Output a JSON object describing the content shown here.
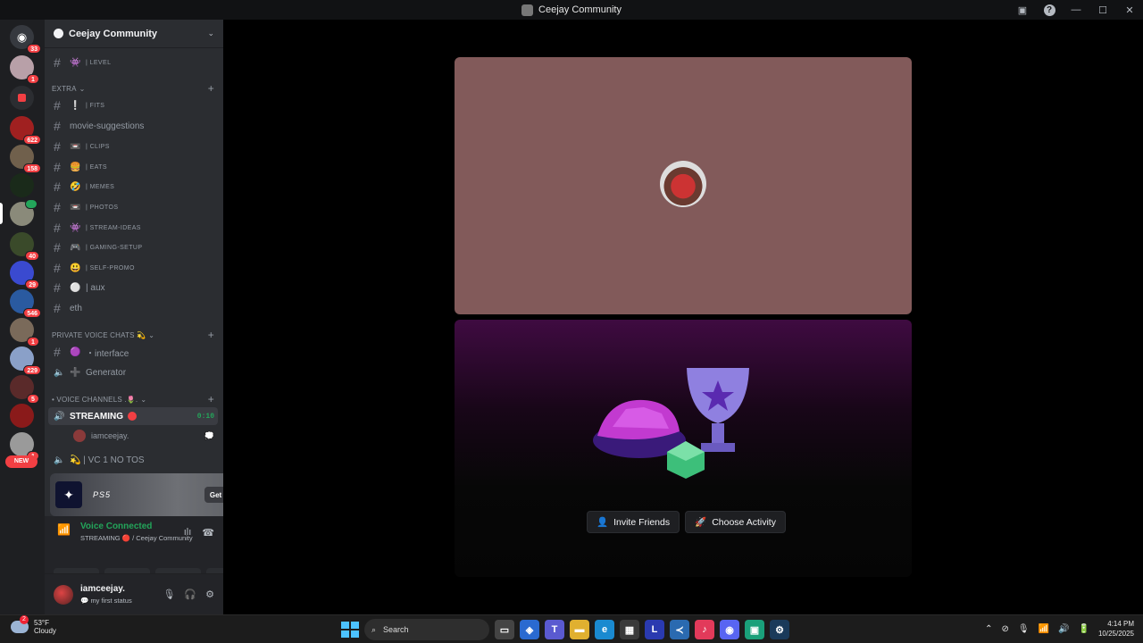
{
  "window": {
    "title": "Ceejay Community"
  },
  "guilds": {
    "badges": [
      "33",
      "1",
      "622",
      "158",
      "1",
      "40",
      "29",
      "546",
      "1",
      "229",
      "5",
      "1"
    ],
    "new_label": "NEW"
  },
  "server": {
    "name": "Ceejay Community"
  },
  "channels": {
    "top": [
      {
        "emoji": "👾",
        "name": "| level",
        "small": true
      }
    ],
    "extra_category": "EXTRA",
    "extra": [
      {
        "emoji": "❕",
        "name": "| fits",
        "small": true
      },
      {
        "emoji": "",
        "name": "movie-suggestions",
        "small": false
      },
      {
        "emoji": "📼",
        "name": "| clips",
        "small": true
      },
      {
        "emoji": "🍔",
        "name": "| eats",
        "small": true
      },
      {
        "emoji": "🤣",
        "name": "| memes",
        "small": true
      },
      {
        "emoji": "📼",
        "name": "| photos",
        "small": true
      },
      {
        "emoji": "👾",
        "name": "| stream-ideas",
        "small": true
      },
      {
        "emoji": "🎮",
        "name": "| gaming-setup",
        "small": true
      },
      {
        "emoji": "😃",
        "name": "| self-promo",
        "small": true
      },
      {
        "emoji": "⚪",
        "name": "| aux",
        "small": false
      },
      {
        "emoji": "",
        "name": "eth",
        "small": false
      }
    ],
    "private_category": "PRIVATE VOICE CHATS 💫",
    "private": [
      {
        "emoji": "🟣",
        "name": "・interface"
      },
      {
        "emoji": "➕",
        "name": "Generator"
      }
    ],
    "voice_category": "• VOICE CHANNELS .🌷.",
    "voice": [
      {
        "name": "STREAMING",
        "timer": "0:10",
        "member": "iamceejay."
      },
      {
        "name": "💫 | VC 1 NO TOS"
      }
    ]
  },
  "promo": {
    "brand": "PS5",
    "button": "Get Reward!"
  },
  "voice_panel": {
    "status": "Voice Connected",
    "detail": "STREAMING 🔴 / Ceejay Community"
  },
  "user": {
    "name": "iamceejay.",
    "status": "my first status"
  },
  "activity": {
    "invite_label": "Invite Friends",
    "choose_label": "Choose Activity"
  },
  "taskbar": {
    "weather_temp": "53°F",
    "weather_desc": "Cloudy",
    "weather_badge": "2",
    "search_placeholder": "Search",
    "time": "4:14 PM",
    "date": "10/25/2025"
  },
  "colors": {
    "accent": "#5865f2",
    "online": "#23a55a",
    "danger": "#f23f43",
    "tile_bg": "#825a5a"
  }
}
